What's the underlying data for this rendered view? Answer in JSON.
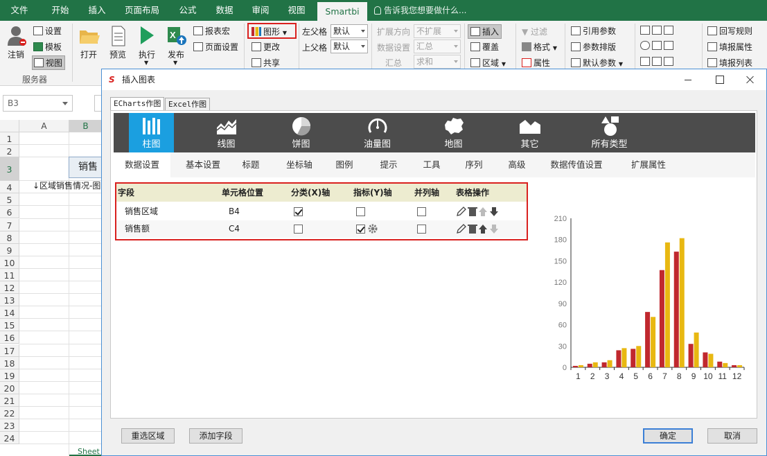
{
  "excel": {
    "tabs": [
      "文件",
      "开始",
      "插入",
      "页面布局",
      "公式",
      "数据",
      "审阅",
      "视图",
      "Smartbi"
    ],
    "active_tab": "Smartbi",
    "tell_me": "告诉我您想要做什么...",
    "ribbon": {
      "login": "注销",
      "settings": "设置",
      "template": "模板",
      "view": "视图",
      "server_group": "服务器",
      "open": "打开",
      "preview": "预览",
      "run": "执行",
      "publish": "发布",
      "report_macro": "报表宏",
      "page_setup": "页面设置",
      "chart": "图形",
      "change": "更改",
      "share": "共享",
      "left_parent": "左父格",
      "top_parent": "上父格",
      "left_parent_value": "默认",
      "top_parent_value": "默认",
      "expand_direction": "扩展方向",
      "expand_direction_value": "不扩展",
      "data_setting": "数据设置",
      "data_setting_value": "汇总",
      "summary": "汇总",
      "summary_value": "求和",
      "insert": "插入",
      "overwrite": "覆盖",
      "area": "区域",
      "filter": "过滤",
      "format": "格式",
      "property": "属性",
      "ref_param": "引用参数",
      "param_layout": "参数排版",
      "default_param": "默认参数",
      "writeback_rule": "回写规则",
      "fill_property": "填报属性",
      "fill_list": "填报列表"
    },
    "namebox": "B3",
    "columns": [
      "A",
      "B"
    ],
    "rows": [
      "1",
      "2",
      "3",
      "4",
      "5",
      "6",
      "7",
      "8",
      "9",
      "10",
      "11",
      "12",
      "13",
      "14",
      "15",
      "16",
      "17",
      "18",
      "19",
      "20",
      "21",
      "22",
      "23",
      "24"
    ],
    "cell_b3": "销售",
    "cell_a4": "↓区域销售情况-图",
    "sheet_tab": "Sheet"
  },
  "dialog": {
    "title": "插入图表",
    "sub_tabs": [
      "ECharts作图",
      "Excel作图"
    ],
    "chart_types": [
      {
        "label": "柱图",
        "icon": "bar-chart-icon"
      },
      {
        "label": "线图",
        "icon": "line-chart-icon"
      },
      {
        "label": "饼图",
        "icon": "pie-chart-icon"
      },
      {
        "label": "油量图",
        "icon": "gauge-chart-icon"
      },
      {
        "label": "地图",
        "icon": "map-chart-icon"
      },
      {
        "label": "其它",
        "icon": "other-chart-icon"
      },
      {
        "label": "所有类型",
        "icon": "all-types-icon"
      }
    ],
    "setting_tabs": [
      "数据设置",
      "基本设置",
      "标题",
      "坐标轴",
      "图例",
      "提示",
      "工具",
      "序列",
      "高级",
      "数据传值设置",
      "扩展属性"
    ],
    "table": {
      "headers": [
        "字段",
        "单元格位置",
        "分类(X)轴",
        "指标(Y)轴",
        "并列轴",
        "表格操作"
      ],
      "rows": [
        {
          "field": "销售区域",
          "cell": "B4",
          "x_axis": true,
          "y_axis": false,
          "parallel": false
        },
        {
          "field": "销售额",
          "cell": "C4",
          "x_axis": false,
          "y_axis": true,
          "parallel": false
        }
      ]
    },
    "buttons": {
      "reselect": "重选区域",
      "add_field": "添加字段",
      "ok": "确定",
      "cancel": "取消"
    }
  },
  "chart_data": {
    "type": "bar",
    "categories": [
      "1",
      "2",
      "3",
      "4",
      "5",
      "6",
      "7",
      "8",
      "9",
      "10",
      "11",
      "12"
    ],
    "series": [
      {
        "color": "#c0282e",
        "values": [
          2,
          5,
          7,
          24,
          26,
          78,
          137,
          163,
          33,
          21,
          8,
          3
        ]
      },
      {
        "color": "#e8b812",
        "values": [
          3,
          7,
          10,
          27,
          30,
          71,
          176,
          182,
          49,
          19,
          6,
          3
        ]
      }
    ],
    "ylim": [
      0,
      210
    ],
    "yticks": [
      "0",
      "30",
      "60",
      "90",
      "120",
      "150",
      "180",
      "210"
    ],
    "grid": false
  }
}
